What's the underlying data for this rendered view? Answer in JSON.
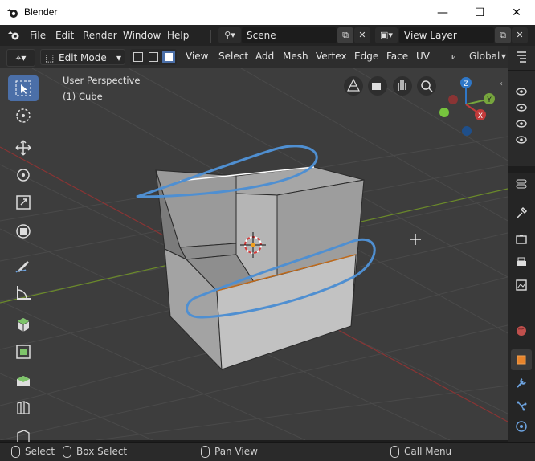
{
  "window": {
    "title": "Blender",
    "minimize_glyph": "—",
    "maximize_glyph": "☐",
    "close_glyph": "✕"
  },
  "menubar": {
    "items": [
      "File",
      "Edit",
      "Render",
      "Window",
      "Help"
    ],
    "scene_value": "Scene",
    "view_layer_value": "View Layer"
  },
  "view_header": {
    "mode": "Edit Mode",
    "menus": [
      "View",
      "Select",
      "Add",
      "Mesh",
      "Vertex",
      "Edge",
      "Face",
      "UV"
    ],
    "orientation": "Global"
  },
  "viewport": {
    "perspective_label": "User Perspective",
    "object_label": "(1) Cube",
    "gizmo_axes": [
      "Z",
      "Y",
      "X"
    ],
    "colors": {
      "background": "#3d3d3d",
      "grid": "#4a4a4a",
      "x_axis": "#8a3434",
      "y_axis": "#6b8a2a",
      "annotation": "#4f8fd1",
      "active_tool": "#4b6fa8"
    }
  },
  "toolbar": {
    "tools": [
      "select-box",
      "cursor",
      "move",
      "rotate",
      "scale",
      "transform",
      "annotate",
      "measure",
      "add-cube",
      "extrude",
      "inset",
      "bevel",
      "loop-cut",
      "knife"
    ]
  },
  "statusbar": {
    "select": "Select",
    "box_select": "Box Select",
    "pan_view": "Pan View",
    "call_menu": "Call Menu"
  }
}
